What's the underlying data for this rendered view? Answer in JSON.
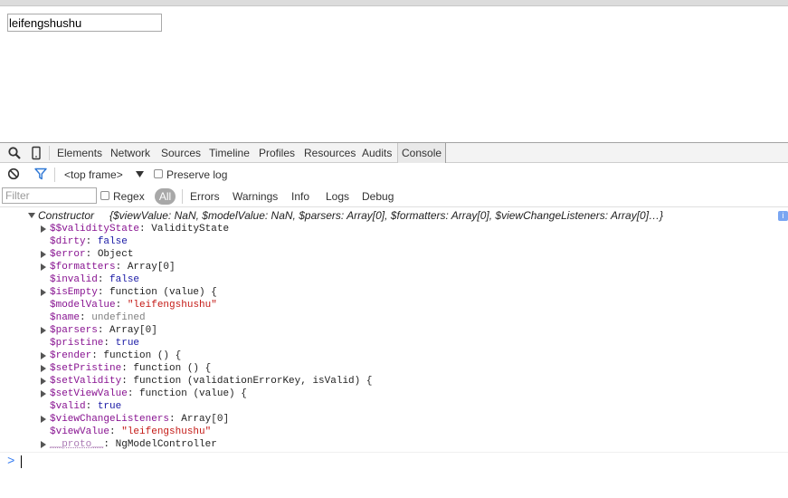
{
  "page": {
    "input_value": "leifengshushu"
  },
  "devtools": {
    "icons": {
      "search": "search-icon",
      "device": "device-mode-icon",
      "clear": "clear-console-icon",
      "filter": "filter-icon"
    },
    "tabs": [
      {
        "label": "Elements"
      },
      {
        "label": "Network"
      },
      {
        "label": "Sources"
      },
      {
        "label": "Timeline"
      },
      {
        "label": "Profiles"
      },
      {
        "label": "Resources"
      },
      {
        "label": "Audits"
      },
      {
        "label": "Console"
      }
    ],
    "active_tab": "Console",
    "context": "<top frame>",
    "preserve_log_label": "Preserve log",
    "filter_placeholder": "Filter",
    "regex_label": "Regex",
    "levels": [
      "All",
      "Errors",
      "Warnings",
      "Info",
      "Logs",
      "Debug"
    ]
  },
  "console": {
    "header": {
      "name": "Constructor",
      "summary": "{$viewValue: NaN, $modelValue: NaN, $parsers: Array[0], $formatters: Array[0], $viewChangeListeners: Array[0]…}",
      "badge": "i"
    },
    "props": [
      {
        "key": "$$validityState",
        "sep": ": ",
        "value": "ValidityState"
      },
      {
        "key": "$dirty",
        "sep": ": ",
        "value": "false"
      },
      {
        "key": "$error",
        "sep": ": ",
        "value": "Object"
      },
      {
        "key": "$formatters",
        "sep": ": ",
        "value": "Array[0]"
      },
      {
        "key": "$invalid",
        "sep": ": ",
        "value": "false"
      },
      {
        "key": "$isEmpty",
        "sep": ": ",
        "value": "function (value) {"
      },
      {
        "key": "$modelValue",
        "sep": ": ",
        "value": "\"leifengshushu\""
      },
      {
        "key": "$name",
        "sep": ": ",
        "value": "undefined"
      },
      {
        "key": "$parsers",
        "sep": ": ",
        "value": "Array[0]"
      },
      {
        "key": "$pristine",
        "sep": ": ",
        "value": "true"
      },
      {
        "key": "$render",
        "sep": ": ",
        "value": "function () {"
      },
      {
        "key": "$setPristine",
        "sep": ": ",
        "value": "function () {"
      },
      {
        "key": "$setValidity",
        "sep": ": ",
        "value": "function (validationErrorKey, isValid) {"
      },
      {
        "key": "$setViewValue",
        "sep": ": ",
        "value": "function (value) {"
      },
      {
        "key": "$valid",
        "sep": ": ",
        "value": "true"
      },
      {
        "key": "$viewChangeListeners",
        "sep": ": ",
        "value": "Array[0]"
      },
      {
        "key": "$viewValue",
        "sep": ": ",
        "value": "\"leifengshushu\""
      },
      {
        "key": "__proto__",
        "sep": ": ",
        "value": "NgModelController"
      }
    ],
    "prompt": ">"
  }
}
